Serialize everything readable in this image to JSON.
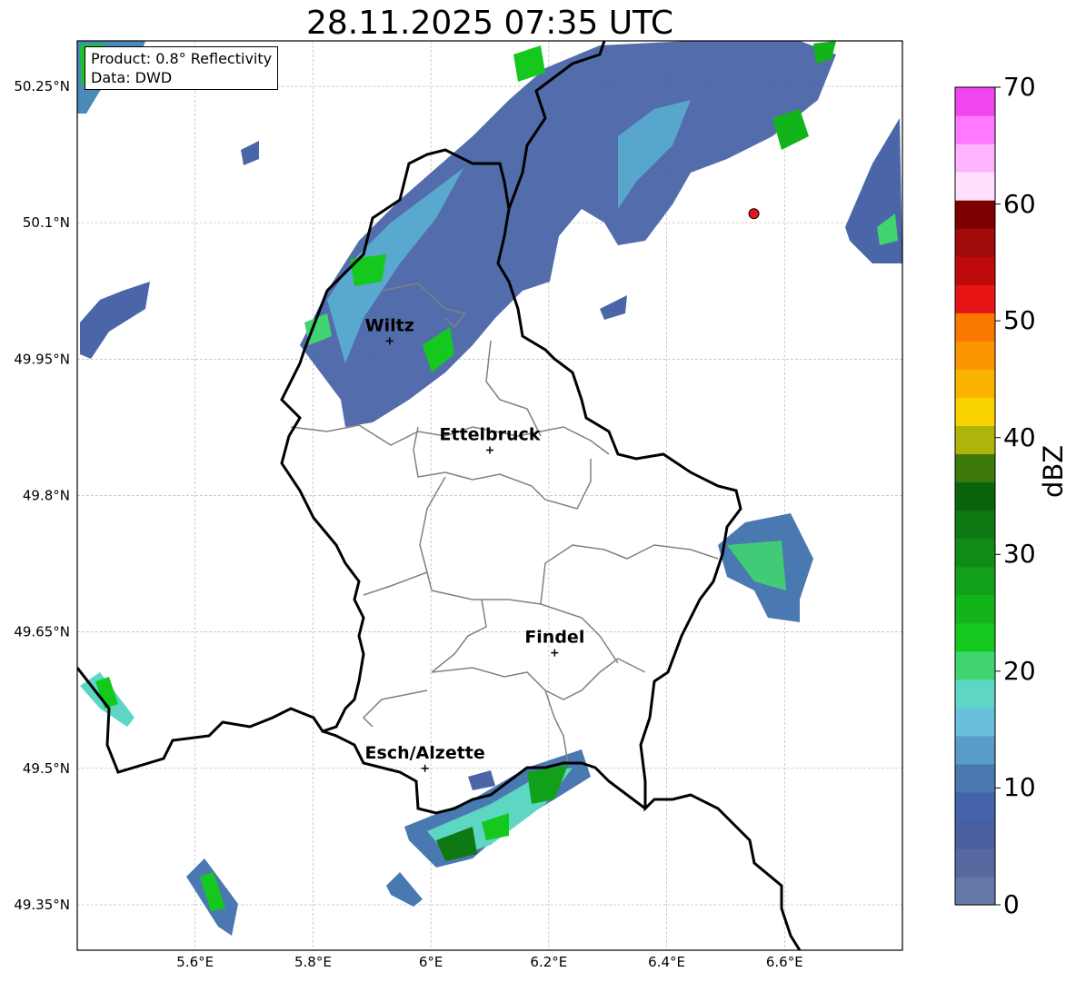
{
  "title": "28.11.2025 07:35 UTC",
  "info_box": {
    "line1": "Product: 0.8° Reflectivity",
    "line2": "Data: DWD"
  },
  "map": {
    "lon_range": [
      5.4,
      6.8
    ],
    "lat_range": [
      49.3,
      50.3
    ],
    "x_ticks": [
      {
        "value": 5.6,
        "label": "5.6°E"
      },
      {
        "value": 5.8,
        "label": "5.8°E"
      },
      {
        "value": 6.0,
        "label": "6°E"
      },
      {
        "value": 6.2,
        "label": "6.2°E"
      },
      {
        "value": 6.4,
        "label": "6.4°E"
      },
      {
        "value": 6.6,
        "label": "6.6°E"
      }
    ],
    "y_ticks": [
      {
        "value": 50.25,
        "label": "50.25°N"
      },
      {
        "value": 50.1,
        "label": "50.1°N"
      },
      {
        "value": 49.95,
        "label": "49.95°N"
      },
      {
        "value": 49.8,
        "label": "49.8°N"
      },
      {
        "value": 49.65,
        "label": "49.65°N"
      },
      {
        "value": 49.5,
        "label": "49.5°N"
      },
      {
        "value": 49.35,
        "label": "49.35°N"
      }
    ],
    "cities": [
      {
        "name": "Wiltz",
        "lon": 5.93,
        "lat": 49.97
      },
      {
        "name": "Ettelbruck",
        "lon": 6.1,
        "lat": 49.85
      },
      {
        "name": "Findel",
        "lon": 6.21,
        "lat": 49.627
      },
      {
        "name": "Esch/Alzette",
        "lon": 5.99,
        "lat": 49.5
      }
    ],
    "radar_site": {
      "lon": 6.548,
      "lat": 50.11,
      "color": "#e8141e"
    }
  },
  "colorbar": {
    "title": "dBZ",
    "min": 0,
    "max": 70,
    "ticks": [
      "0",
      "10",
      "20",
      "30",
      "40",
      "50",
      "60",
      "70"
    ],
    "colors": [
      "#6478a8",
      "#56689f",
      "#4a5f9f",
      "#4563a8",
      "#4a78b0",
      "#5a9cc8",
      "#68c0dc",
      "#5ed6c4",
      "#40d470",
      "#14c81e",
      "#12b41a",
      "#12a01a",
      "#108c16",
      "#0e7812",
      "#0a640e",
      "#3c780a",
      "#afb40a",
      "#fad200",
      "#fab400",
      "#fa9600",
      "#fa7800",
      "#e61414",
      "#be0a0a",
      "#a00a0a",
      "#7d0000",
      "#ffe0ff",
      "#ffb4ff",
      "#ff78ff",
      "#f046f0"
    ]
  }
}
